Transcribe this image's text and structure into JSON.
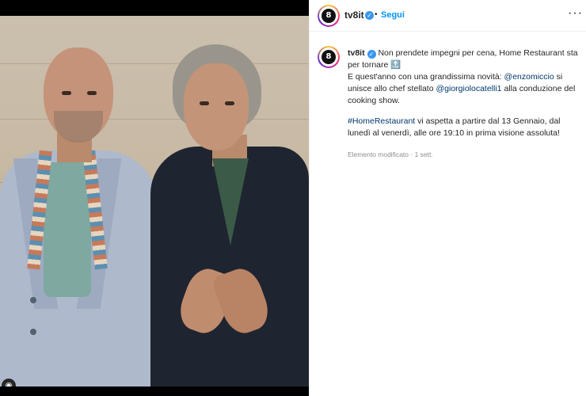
{
  "post": {
    "account": "tv8it",
    "avatar_text": "8",
    "follow_label": "Segui",
    "dot": "•",
    "more_label": "···",
    "caption": {
      "line1": "Non prendete impegni per cena, Home Restaurant sta per tornare",
      "line2_pre": "E quest'anno con una grandissima novità: ",
      "mention1": "@enzomiccio",
      "line2_mid": " si unisce allo chef stellato ",
      "mention2": "@giorgiolocatelli1",
      "line2_post": " alla conduzione del cooking show.",
      "hashtag": "#HomeRestaurant",
      "line3": " vi aspetta a partire dal 13 Gennaio, dal lunedì al venerdì, alle ore 19:10 in prima visione assoluta!"
    },
    "meta": "Elemento modificato · 1 sett."
  },
  "icons": {
    "verified": "verified-check-icon",
    "more": "more-options-icon",
    "photo_badge": "account-badge-icon"
  },
  "colors": {
    "link_blue": "#0095f6",
    "mention": "#00376b",
    "verified": "#3897f0"
  }
}
